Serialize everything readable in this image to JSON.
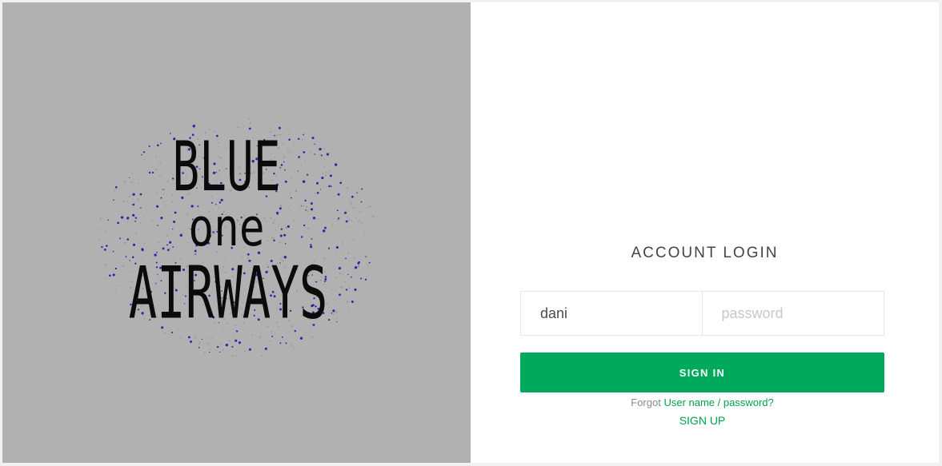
{
  "brand": {
    "logo_line1": "BLUE",
    "logo_line2": "one",
    "logo_line3": "AIRWAYS"
  },
  "login": {
    "title": "ACCOUNT LOGIN",
    "username_value": "dani",
    "password_placeholder": "password",
    "signin_label": "SIGN IN",
    "forgot_prefix": "Forgot",
    "forgot_link": "User name / password?",
    "signup_label": "SIGN UP"
  },
  "colors": {
    "left_panel_bg": "#b1b1b1",
    "accent_green": "#00a95c",
    "link_green": "#00a24f",
    "logo_speckle_blue": "#1a1aa8"
  }
}
